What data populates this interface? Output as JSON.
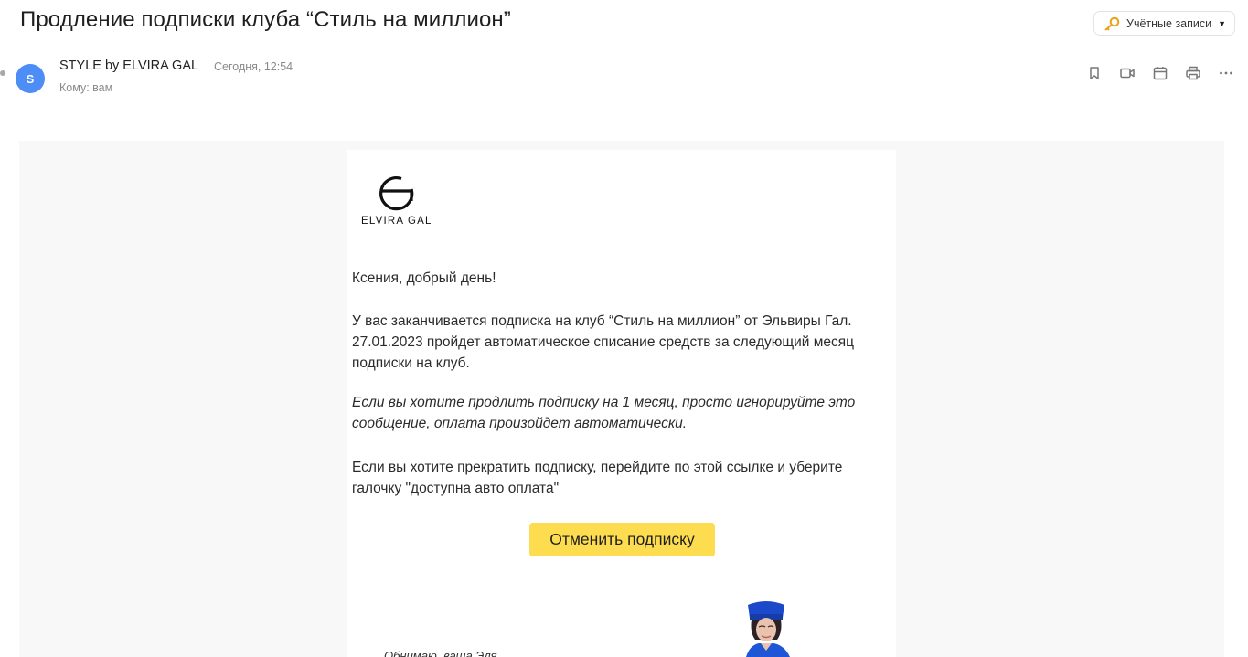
{
  "header": {
    "subject": "Продление подписки клуба “Стиль на миллион”",
    "accounts_label": "Учётные записи"
  },
  "message": {
    "avatar_letter": "S",
    "sender": "STYLE by ELVIRA GAL",
    "date": "Сегодня, 12:54",
    "to": "Кому: вам"
  },
  "toolbar": {
    "icons": [
      "bookmark-icon",
      "video-icon",
      "calendar-icon",
      "print-icon",
      "more-icon"
    ]
  },
  "body": {
    "logo_text": "ELVIRA GAL",
    "greeting": "Ксения, добрый день!",
    "paragraph1": "У вас заканчивается подписка на клуб “Стиль на миллион” от Эльвиры Гал. 27.01.2023 пройдет автоматическое списание средств за следующий месяц подписки на клуб.",
    "paragraph2": "Если вы хотите продлить подписку на 1 месяц, просто игнорируйте это сообщение, оплата произойдет автоматически.",
    "paragraph3": "Если вы хотите прекратить подписку, перейдите по этой ссылке и уберите галочку \"доступна авто оплата\"",
    "cancel_button": "Отменить подписку",
    "signature": "Обнимаю, ваша Эля"
  },
  "colors": {
    "avatar": "#4d8df6",
    "button": "#fedc4f",
    "key_icon": "#e8a317"
  }
}
